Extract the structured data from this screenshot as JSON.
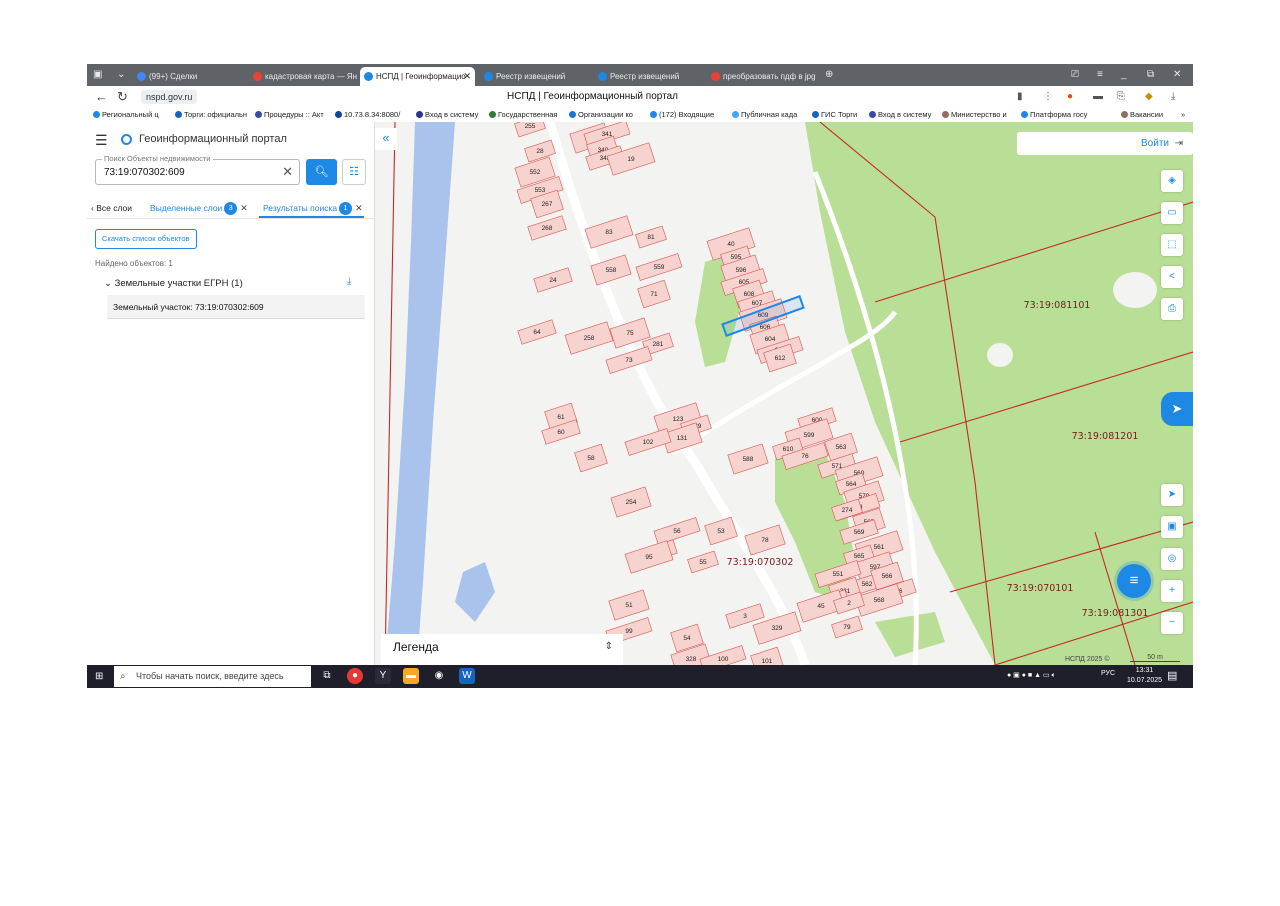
{
  "browser": {
    "tabs": [
      {
        "label": "(99+) Сделки",
        "color": "#4285f4"
      },
      {
        "label": "кадастровая карта — Ян",
        "color": "#ea4335"
      },
      {
        "label": "НСПД | Геоинформацио",
        "color": "#1e88e5"
      },
      {
        "label": "Реестр извещений",
        "color": "#1e88e5"
      },
      {
        "label": "Реестр извещений",
        "color": "#1e88e5"
      },
      {
        "label": "преобразовать пдф в jpg",
        "color": "#ea4335"
      }
    ],
    "url": "nspd.gov.ru",
    "page_title": "НСПД | Геоинформационный портал",
    "bookmarks": [
      "Региональный ц",
      "Торги: официальн",
      "Процедуры :: Акт",
      "10.73.8.34:8080/",
      "Вход в систему",
      "Государственная",
      "Организации ко",
      "(172) Входящие",
      "Публичная када",
      "ГИС Торги",
      "Вход в систему",
      "Министерство и",
      "Платформа госу",
      "Вакансии"
    ]
  },
  "portal": {
    "title": "Геоинформационный портал",
    "search": {
      "label": "Поиск Объекты недвижимости",
      "value": "73:19:070302:609"
    },
    "tabs": {
      "all_layers": "Все слои",
      "selected_layers": "Выделенные слои",
      "selected_count": "3",
      "results": "Результаты поиска",
      "results_count": "1"
    },
    "download_button": "Скачать список объектов",
    "found_text": "Найдено объектов: 1",
    "group": "Земельные участки ЕГРН (1)",
    "result_item": "Земельный участок: 73:19:070302:609"
  },
  "map": {
    "login": "Войти",
    "legend": "Легенда",
    "copyright": "НСПД 2025 ©",
    "scale": "50 m",
    "quarters": [
      {
        "id": "q-081101",
        "label": "73:19:081101"
      },
      {
        "id": "q-081201",
        "label": "73:19:081201"
      },
      {
        "id": "q-070302",
        "label": "73:19:070302"
      },
      {
        "id": "q-070101",
        "label": "73:19:070101"
      },
      {
        "id": "q-081301",
        "label": "73:19:081301"
      }
    ],
    "parcels": [
      "255",
      "343",
      "341",
      "340",
      "342",
      "19",
      "28",
      "552",
      "553",
      "267",
      "268",
      "83",
      "81",
      "558",
      "559",
      "71",
      "24",
      "40",
      "595",
      "596",
      "605",
      "608",
      "607",
      "609",
      "606",
      "604",
      "614",
      "612",
      "64",
      "258",
      "281",
      "75",
      "73",
      "61",
      "60",
      "123",
      "129",
      "131",
      "102",
      "58",
      "600",
      "599",
      "610",
      "588",
      "76",
      "563",
      "571",
      "560",
      "564",
      "570",
      "598",
      "567",
      "569",
      "561",
      "565",
      "597",
      "562",
      "566",
      "616",
      "568",
      "274",
      "254",
      "56",
      "53",
      "333",
      "95",
      "55",
      "78",
      "551",
      "331",
      "13",
      "45",
      "2",
      "51",
      "99",
      "54",
      "3",
      "329",
      "79",
      "328",
      "100",
      "101"
    ],
    "colors": {
      "parcel_fill": "#f7d3cf",
      "parcel_stroke": "#d9534f",
      "forest": "#b9df96",
      "river": "#a9c3ec",
      "selected": "#1e88e5"
    }
  },
  "taskbar": {
    "search_placeholder": "Чтобы начать поиск, введите здесь запрос",
    "lang": "РУС",
    "time": "13:31",
    "date": "10.07.2025"
  }
}
